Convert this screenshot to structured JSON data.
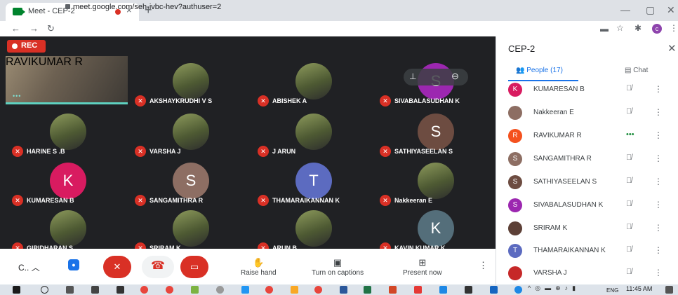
{
  "browser": {
    "tab_title": "Meet - CEP-2",
    "tab_close": "×",
    "new_tab": "+",
    "url": "meet.google.com/seh-ivbc-hev?authuser=2",
    "profile_initial": "c",
    "window_controls": [
      "—",
      "▢",
      "✕"
    ]
  },
  "meeting": {
    "rec_label": "REC",
    "tiles": [
      {
        "name": "RAVIKUMAR R",
        "speaking": true
      },
      {
        "name": "AKSHAYKRUDHI V S",
        "avatar": "photo"
      },
      {
        "name": "ABISHEK A",
        "avatar": "photo"
      },
      {
        "name": "SIVABALASUDHAN K",
        "initial": "S",
        "color": "#9c27b0"
      },
      {
        "name": "HARINE S .B",
        "avatar": "photo"
      },
      {
        "name": "VARSHA J",
        "avatar": "photo"
      },
      {
        "name": "J ARUN",
        "avatar": "photo"
      },
      {
        "name": "SATHIYASEELAN S",
        "initial": "S",
        "color": "#6d4c41"
      },
      {
        "name": "KUMARESAN B",
        "initial": "K",
        "color": "#d81b60"
      },
      {
        "name": "SANGAMITHRA R",
        "initial": "S",
        "color": "#8d6e63"
      },
      {
        "name": "THAMARAIKANNAN K",
        "initial": "T",
        "color": "#5c6bc0"
      },
      {
        "name": "Nakkeeran E",
        "avatar": "photo"
      },
      {
        "name": "GIRIDHARAN S",
        "avatar": "photo"
      },
      {
        "name": "SRIRAM K",
        "avatar": "photo"
      },
      {
        "name": "ARUN B",
        "avatar": "photo"
      },
      {
        "name": "KAVIN KUMAR K",
        "initial": "K",
        "color": "#546e7a"
      }
    ]
  },
  "bottom_bar": {
    "meeting_code": "C..",
    "raise_hand": "Raise hand",
    "captions": "Turn on captions",
    "present": "Present now"
  },
  "panel": {
    "title": "CEP-2",
    "people_tab": "People (17)",
    "chat_tab": "Chat",
    "participants": [
      {
        "name": "KUMARESAN B",
        "initial": "K",
        "color": "#d81b60",
        "status": "muted"
      },
      {
        "name": "Nakkeeran E",
        "initial": "",
        "color": "#8d6e63",
        "status": "muted"
      },
      {
        "name": "RAVIKUMAR R",
        "initial": "R",
        "color": "#f4511e",
        "status": "speaking"
      },
      {
        "name": "SANGAMITHRA R",
        "initial": "S",
        "color": "#8d6e63",
        "status": "muted"
      },
      {
        "name": "SATHIYASEELAN S",
        "initial": "S",
        "color": "#6d4c41",
        "status": "muted"
      },
      {
        "name": "SIVABALASUDHAN K",
        "initial": "S",
        "color": "#9c27b0",
        "status": "muted"
      },
      {
        "name": "SRIRAM K",
        "initial": "",
        "color": "#5d4037",
        "status": "muted"
      },
      {
        "name": "THAMARAIKANNAN K",
        "initial": "T",
        "color": "#5c6bc0",
        "status": "muted"
      },
      {
        "name": "VARSHA J",
        "initial": "",
        "color": "#c62828",
        "status": "muted"
      }
    ]
  },
  "taskbar": {
    "time": "11:45 AM",
    "lang": "ENG"
  }
}
